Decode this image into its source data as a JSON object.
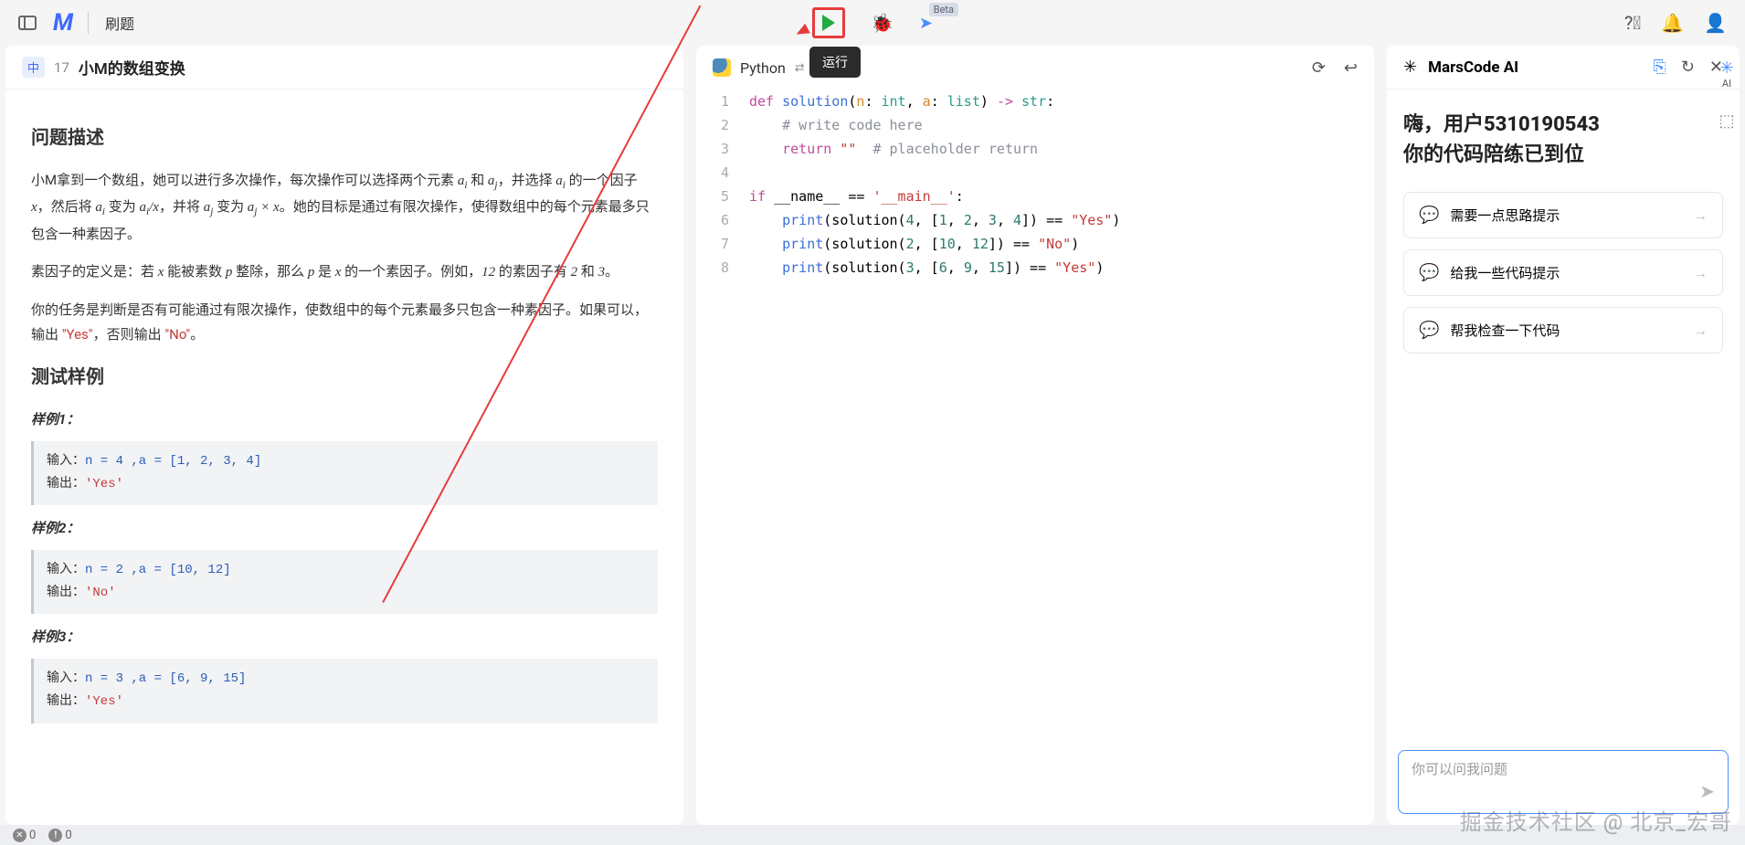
{
  "topbar": {
    "nav_text": "刷题",
    "run_tooltip": "运行",
    "beta_label": "Beta"
  },
  "problem": {
    "difficulty": "中",
    "number": "17",
    "title": "小M的数组变换",
    "desc_heading": "问题描述",
    "p1_pre": "小M拿到一个数组，她可以进行多次操作，每次操作可以选择两个元素 ",
    "ai": "aᵢ",
    "and1": " 和 ",
    "aj": "aⱼ",
    "p1_mid1": "，并选择 ",
    "p1_mid2": " 的一个因子 ",
    "x": "x",
    "p1_mid3": "，然后将 ",
    "p1_mid4": " 变为 ",
    "aix": "aᵢ/x",
    "p1_mid5": "，并将 ",
    "p1_mid6": " 变为 ",
    "ajx": "aⱼ × x",
    "p1_end": "。她的目标是通过有限次操作，使得数组中的每个元素最多只包含一种素因子。",
    "p2": "素因子的定义是：若 x 能被素数 p 整除，那么 p 是 x 的一个素因子。例如，12 的素因子有 2 和 3。",
    "p3_a": "你的任务是判断是否有可能通过有限次操作，使数组中的每个元素最多只包含一种素因子。如果可以，输出 ",
    "yes": "\"Yes\"",
    "p3_b": "，否则输出 ",
    "no": "\"No\"",
    "p3_c": "。",
    "test_heading": "测试样例",
    "samples": [
      {
        "label": "样例1：",
        "in_lbl": "输入：",
        "in_val": "n = 4 ,a = [1, 2, 3, 4]",
        "out_lbl": "输出：",
        "out_val": "'Yes'"
      },
      {
        "label": "样例2：",
        "in_lbl": "输入：",
        "in_val": "n = 2 ,a = [10, 12]",
        "out_lbl": "输出：",
        "out_val": "'No'"
      },
      {
        "label": "样例3：",
        "in_lbl": "输入：",
        "in_val": "n = 3 ,a = [6, 9, 15]",
        "out_lbl": "输出：",
        "out_val": "'Yes'"
      }
    ]
  },
  "editor": {
    "language": "Python",
    "line_numbers": [
      "1",
      "2",
      "3",
      "4",
      "5",
      "6",
      "7",
      "8"
    ]
  },
  "ai": {
    "brand": "MarsCode AI",
    "greet_l1": "嗨，用户5310190543",
    "greet_l2": "你的代码陪练已到位",
    "suggestions": [
      "需要一点思路提示",
      "给我一些代码提示",
      "帮我检查一下代码"
    ],
    "input_placeholder": "你可以问我问题"
  },
  "right_rail": {
    "ai_label": "AI"
  },
  "statusbar": {
    "errors": "0",
    "warnings": "0"
  },
  "watermark": "掘金技术社区 @ 北京_宏哥"
}
